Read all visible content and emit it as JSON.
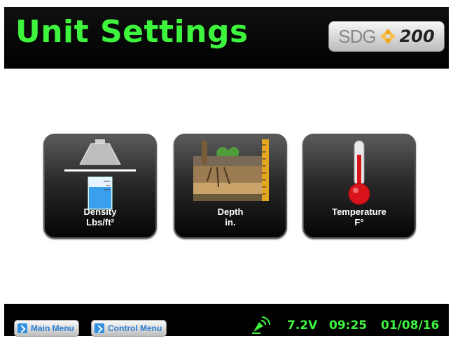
{
  "header": {
    "title": "Unit Settings",
    "logo": {
      "brand": "SDG",
      "model": "200"
    }
  },
  "tiles": [
    {
      "icon": "density-beaker-icon",
      "label_line1": "Density",
      "label_line2": "Lbs/ft³"
    },
    {
      "icon": "soil-depth-icon",
      "label_line1": "Depth",
      "label_line2": "in."
    },
    {
      "icon": "thermometer-icon",
      "label_line1": "Temperature",
      "label_line2": "F°"
    }
  ],
  "footer": {
    "main_menu_label": "Main Menu",
    "control_menu_label": "Control Menu",
    "voltage": "7.2V",
    "time": "09:25",
    "date": "01/08/16"
  },
  "colors": {
    "accent_green": "#3df53d",
    "button_blue": "#2b7fd0"
  }
}
